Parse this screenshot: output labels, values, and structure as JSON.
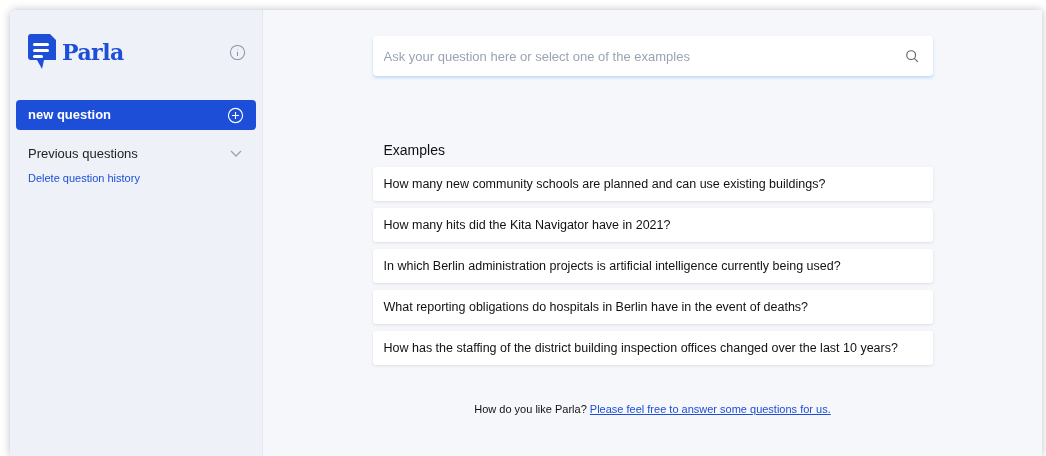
{
  "sidebar": {
    "brand": "Parla",
    "new_question": "new question",
    "previous_questions": {
      "label": "Previous questions",
      "expanded": false
    },
    "delete_history": "Delete question history"
  },
  "search": {
    "placeholder": "Ask your question here or select one of the examples"
  },
  "examples": {
    "heading": "Examples",
    "items": [
      "How many new community schools are planned and can use existing buildings?",
      "How many hits did the Kita Navigator have in 2021?",
      "In which Berlin administration projects is artificial intelligence currently being used?",
      "What reporting obligations do hospitals in Berlin have in the event of deaths?",
      "How has the staffing of the district building inspection offices changed over the last 10 years?"
    ]
  },
  "feedback": {
    "text": "How do you like Parla?",
    "link": "Please feel free to answer some questions for us."
  }
}
